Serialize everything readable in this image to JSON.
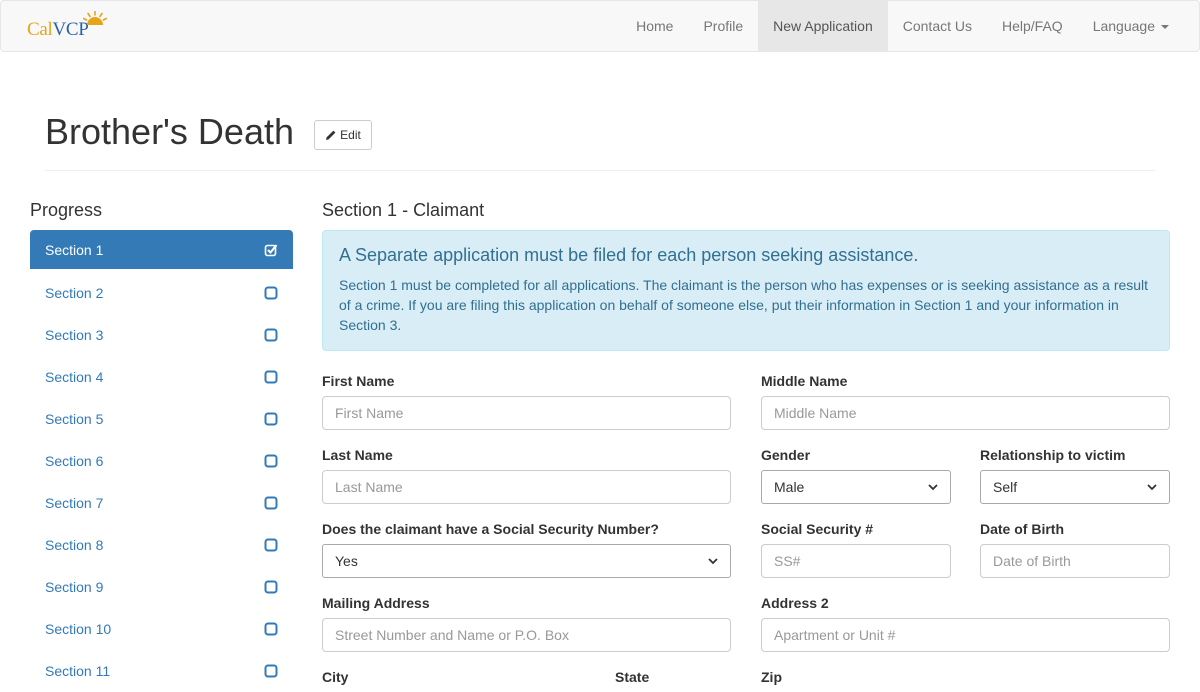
{
  "brand": {
    "part1": "Cal",
    "part2": "VCP"
  },
  "nav": {
    "home": "Home",
    "profile": "Profile",
    "new_application": "New Application",
    "contact": "Contact Us",
    "help": "Help/FAQ",
    "language": "Language"
  },
  "page": {
    "title": "Brother's Death",
    "edit_label": "Edit"
  },
  "sidebar": {
    "title": "Progress",
    "items": [
      {
        "label": "Section 1",
        "checked": true
      },
      {
        "label": "Section 2",
        "checked": false
      },
      {
        "label": "Section 3",
        "checked": false
      },
      {
        "label": "Section 4",
        "checked": false
      },
      {
        "label": "Section 5",
        "checked": false
      },
      {
        "label": "Section 6",
        "checked": false
      },
      {
        "label": "Section 7",
        "checked": false
      },
      {
        "label": "Section 8",
        "checked": false
      },
      {
        "label": "Section 9",
        "checked": false
      },
      {
        "label": "Section 10",
        "checked": false
      },
      {
        "label": "Section 11",
        "checked": false
      }
    ]
  },
  "main": {
    "heading_part1": "Section 1",
    "heading_sep": " - ",
    "heading_part2": "Claimant",
    "alert_title": "A Separate application must be filed for each person seeking assistance.",
    "alert_text": "Section 1 must be completed for all applications. The claimant is the person who has expenses or is seeking assistance as a result of a crime. If you are filing this application on behalf of someone else, put their information in Section 1 and your information in Section 3."
  },
  "form": {
    "first_name": {
      "label": "First Name",
      "placeholder": "First Name"
    },
    "middle_name": {
      "label": "Middle Name",
      "placeholder": "Middle Name"
    },
    "last_name": {
      "label": "Last Name",
      "placeholder": "Last Name"
    },
    "gender": {
      "label": "Gender",
      "value": "Male"
    },
    "relationship": {
      "label": "Relationship to victim",
      "value": "Self"
    },
    "has_ssn": {
      "label": "Does the claimant have a Social Security Number?",
      "value": "Yes"
    },
    "ssn": {
      "label": "Social Security #",
      "placeholder": "SS#"
    },
    "dob": {
      "label": "Date of Birth",
      "placeholder": "Date of Birth"
    },
    "mailing_address": {
      "label": "Mailing Address",
      "placeholder": "Street Number and Name or P.O. Box"
    },
    "address2": {
      "label": "Address 2",
      "placeholder": "Apartment or Unit #"
    },
    "city": {
      "label": "City"
    },
    "state": {
      "label": "State"
    },
    "zip": {
      "label": "Zip"
    }
  },
  "colors": {
    "primary": "#337ab7",
    "alert_bg": "#d9edf7",
    "alert_text": "#31708f",
    "brand_gold": "#e6a519",
    "brand_blue": "#2a63a6"
  }
}
